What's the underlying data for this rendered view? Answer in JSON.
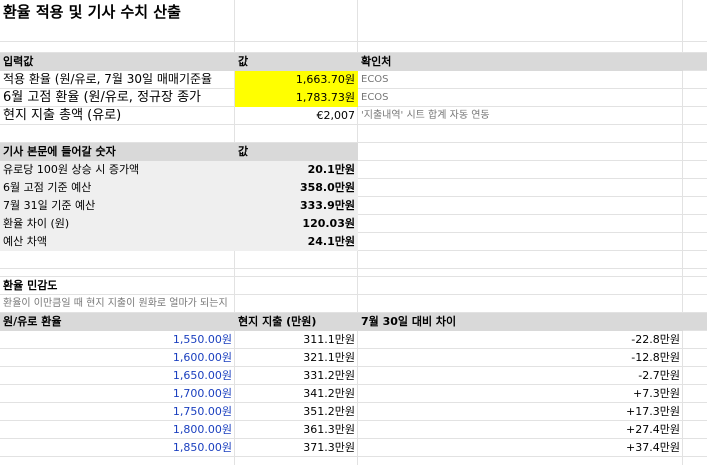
{
  "title": "환율 적용 및 기사 수치 산출",
  "inputs": {
    "headers": [
      "입력값",
      "값",
      "확인처"
    ],
    "rows": [
      {
        "label": "적용 환율 (원/유로, 7월 30일 매매기준율",
        "value": "1,663.70원",
        "source": "ECOS"
      },
      {
        "label": "6월 고점 환율 (원/유로, 정규장 종가",
        "value": "1,783.73원",
        "source": "ECOS"
      },
      {
        "label": "현지 지출 총액 (유로)",
        "value": "€2,007",
        "source": "'지출내역' 시트 합계 자동 연동"
      }
    ]
  },
  "article": {
    "headers": [
      "기사 본문에 들어갈 숫자",
      "값"
    ],
    "rows": [
      {
        "label": "유로당 100원 상승 시 증가액",
        "value": "20.1만원"
      },
      {
        "label": "6월 고점 기준 예산",
        "value": "358.0만원"
      },
      {
        "label": "7월 31일 기준 예산",
        "value": "333.9만원"
      },
      {
        "label": "환율 차이 (원)",
        "value": "120.03원"
      },
      {
        "label": "예산 차액",
        "value": "24.1만원"
      }
    ]
  },
  "sensitivity": {
    "title": "환율 민감도",
    "subtitle": "환율이 이만큼일 때 현지 지출이 원화로 얼마가 되는지",
    "headers": [
      "원/유로 환율",
      "현지 지출 (만원)",
      "7월 30일 대비 차이"
    ],
    "rows": [
      {
        "rate": "1,550.00원",
        "spend": "311.1만원",
        "diff": "-22.8만원"
      },
      {
        "rate": "1,600.00원",
        "spend": "321.1만원",
        "diff": "-12.8만원"
      },
      {
        "rate": "1,650.00원",
        "spend": "331.2만원",
        "diff": "-2.7만원"
      },
      {
        "rate": "1,700.00원",
        "spend": "341.2만원",
        "diff": "+7.3만원"
      },
      {
        "rate": "1,750.00원",
        "spend": "351.2만원",
        "diff": "+17.3만원"
      },
      {
        "rate": "1,800.00원",
        "spend": "361.3만원",
        "diff": "+27.4만원"
      },
      {
        "rate": "1,850.00원",
        "spend": "371.3만원",
        "diff": "+37.4만원"
      }
    ]
  },
  "colors": {
    "highlight": "#ffff00",
    "header_bg": "#d9d9d9",
    "rate_text": "#1a3fbf"
  }
}
